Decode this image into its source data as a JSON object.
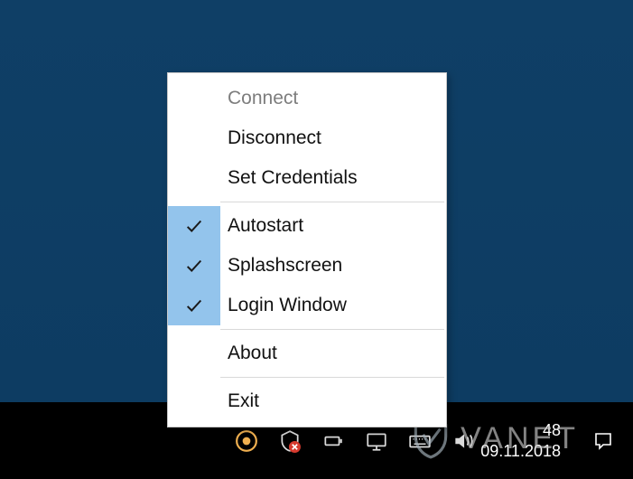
{
  "menu": {
    "items": [
      {
        "label": "Connect",
        "disabled": true,
        "checked": false
      },
      {
        "label": "Disconnect",
        "disabled": false,
        "checked": false
      },
      {
        "label": "Set Credentials",
        "disabled": false,
        "checked": false
      }
    ],
    "items2": [
      {
        "label": "Autostart",
        "checked": true
      },
      {
        "label": "Splashscreen",
        "checked": true
      },
      {
        "label": "Login Window",
        "checked": true
      }
    ],
    "items3": [
      {
        "label": "About"
      }
    ],
    "items4": [
      {
        "label": "Exit"
      }
    ]
  },
  "taskbar": {
    "time_suffix": "48",
    "date": "09.11.2018"
  },
  "watermark": {
    "text": "VANET"
  }
}
